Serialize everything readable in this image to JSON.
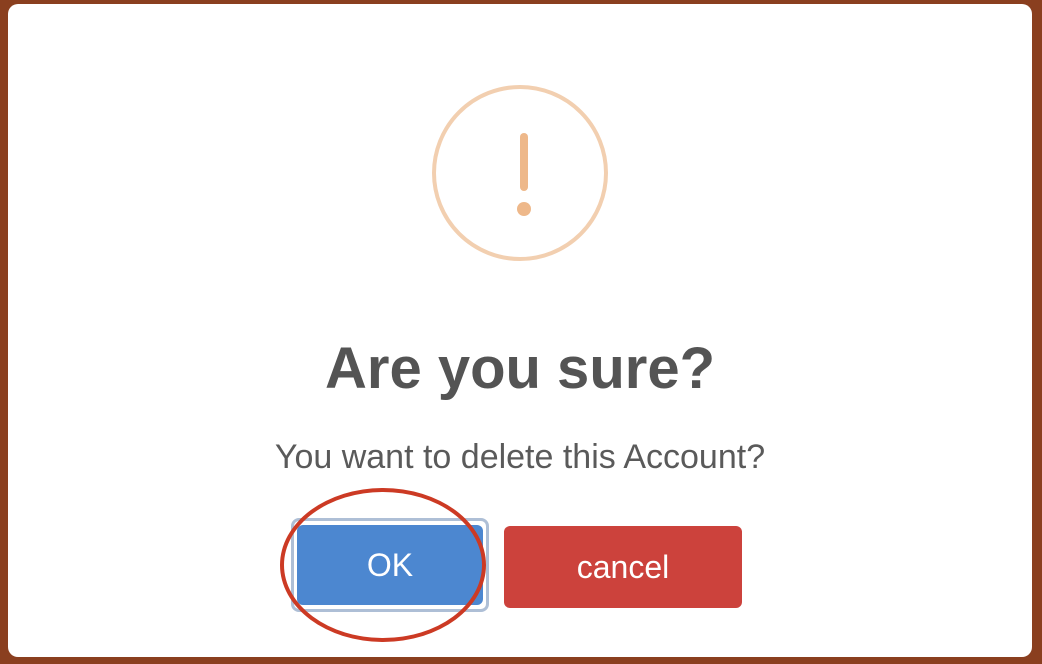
{
  "dialog": {
    "title": "Are you sure?",
    "message": "You want to delete this Account?",
    "icon": "warning-exclamation-icon",
    "ok_label": "OK",
    "cancel_label": "cancel"
  },
  "colors": {
    "background_border": "#8a3f1f",
    "warning_icon": "#eeb88a",
    "ok_button": "#4c87d0",
    "cancel_button": "#cc423c",
    "annotation": "#cc3a24"
  }
}
